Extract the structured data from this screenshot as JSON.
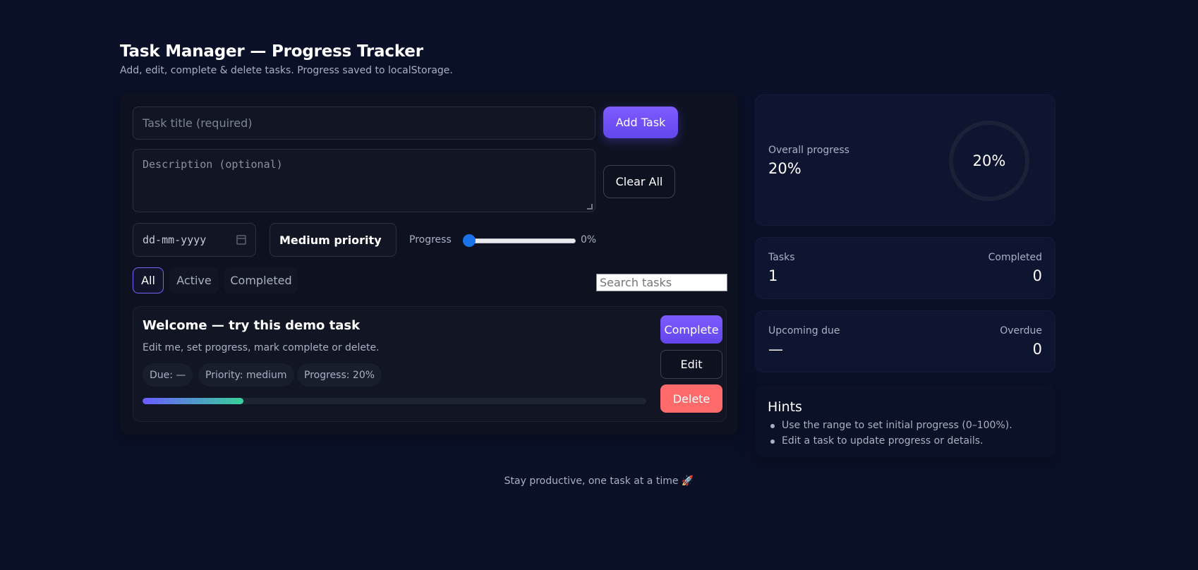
{
  "header": {
    "title": "Task Manager — Progress Tracker",
    "subtitle": "Add, edit, complete & delete tasks. Progress saved to localStorage."
  },
  "form": {
    "title_placeholder": "Task title (required)",
    "description_placeholder": "Description (optional)",
    "date_placeholder": "dd-mm-yyyy",
    "priority_selected": "Medium priority",
    "progress_label": "Progress",
    "progress_value": 0,
    "progress_display": "0%",
    "add_label": "Add Task",
    "clear_label": "Clear All"
  },
  "filters": {
    "all": "All",
    "active": "Active",
    "completed": "Completed",
    "selected": "All",
    "search_placeholder": "Search tasks"
  },
  "tasks": [
    {
      "title": "Welcome — try this demo task",
      "description": "Edit me, set progress, mark complete or delete.",
      "due": "Due: —",
      "priority": "Priority: medium",
      "progress_text": "Progress: 20%",
      "progress": 20,
      "complete_label": "Complete",
      "edit_label": "Edit",
      "delete_label": "Delete"
    }
  ],
  "overall": {
    "label": "Overall progress",
    "value": "20%",
    "ring_value": 20
  },
  "stats": {
    "tasks_label": "Tasks",
    "tasks_value": "1",
    "completed_label": "Completed",
    "completed_value": "0"
  },
  "due": {
    "upcoming_label": "Upcoming due",
    "upcoming_value": "—",
    "overdue_label": "Overdue",
    "overdue_value": "0"
  },
  "hints": {
    "title": "Hints",
    "items": [
      "Use the range to set initial progress (0–100%).",
      "Edit a task to update progress or details."
    ]
  },
  "footer": "Stay productive, one task at a time 🚀",
  "colors": {
    "background": "#0a1028",
    "accent": "#7d5cff",
    "danger": "#ff6b6b",
    "progress_start": "#6a5cff",
    "progress_end": "#38d19a"
  }
}
